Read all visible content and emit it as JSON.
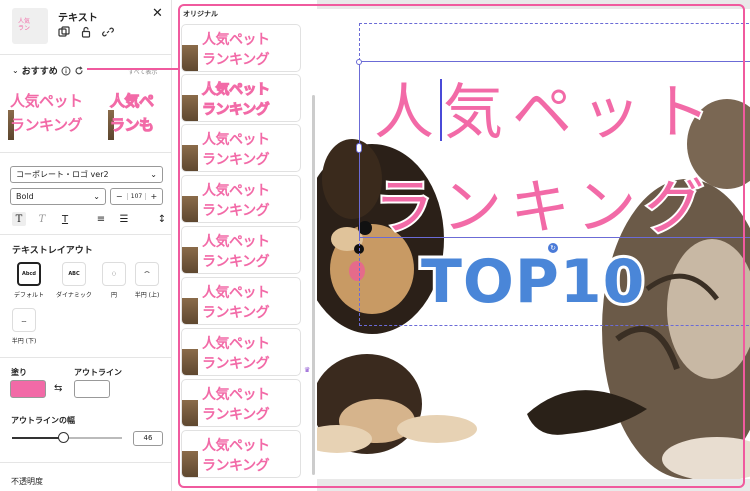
{
  "left_panel": {
    "title": "テキスト",
    "thumb_text": "人気\nラン",
    "recommended_label": "おすすめ",
    "show_all": "すべて表示",
    "preset_line1": "人気ペット",
    "preset_line2": "ランキング",
    "preset2_line1": "人気ペ",
    "preset2_line2": "ランも",
    "font_name": "コーポレート・ロゴ ver2",
    "font_weight": "Bold",
    "font_size": "107",
    "stepper_minus": "−",
    "stepper_plus": "+",
    "text_layout_title": "テキストレイアウト",
    "layouts": [
      {
        "label": "デフォルト",
        "icon_text": "Abcd"
      },
      {
        "label": "ダイナミック",
        "icon_text": "ABC"
      },
      {
        "label": "円",
        "icon_text": ""
      },
      {
        "label": "半円 (上)",
        "icon_text": ""
      },
      {
        "label": "半円 (下)",
        "icon_text": ""
      }
    ],
    "fill_label": "塗り",
    "outline_label": "アウトライン",
    "outline_width_label": "アウトラインの幅",
    "outline_width_value": "46",
    "outline_width_fraction": 0.46,
    "opacity_label": "不透明度",
    "fill_color": "#f26aa7"
  },
  "middle_panel": {
    "title": "オリジナル",
    "item_line1": "人気ペット",
    "item_line2": "ランキング",
    "item_line1_alt": "人気ペット",
    "item_line2_alt": "ランキング"
  },
  "canvas": {
    "title_line1": "人気ペット",
    "title_line2": "ランキング",
    "badge": "TOP10",
    "title_color": "#f26aa7",
    "badge_color": "#4a86d8"
  }
}
